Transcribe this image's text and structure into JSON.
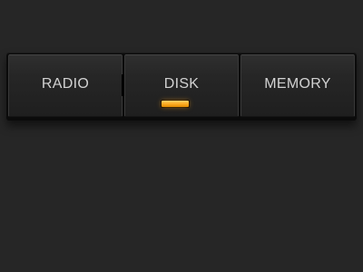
{
  "mode_bar": {
    "buttons": [
      {
        "label": "RADIO",
        "active": false
      },
      {
        "label": "DISK",
        "active": true
      },
      {
        "label": "MEMORY",
        "active": false
      }
    ],
    "indicator_color": "#ffb22a",
    "background_color": "#262626"
  }
}
